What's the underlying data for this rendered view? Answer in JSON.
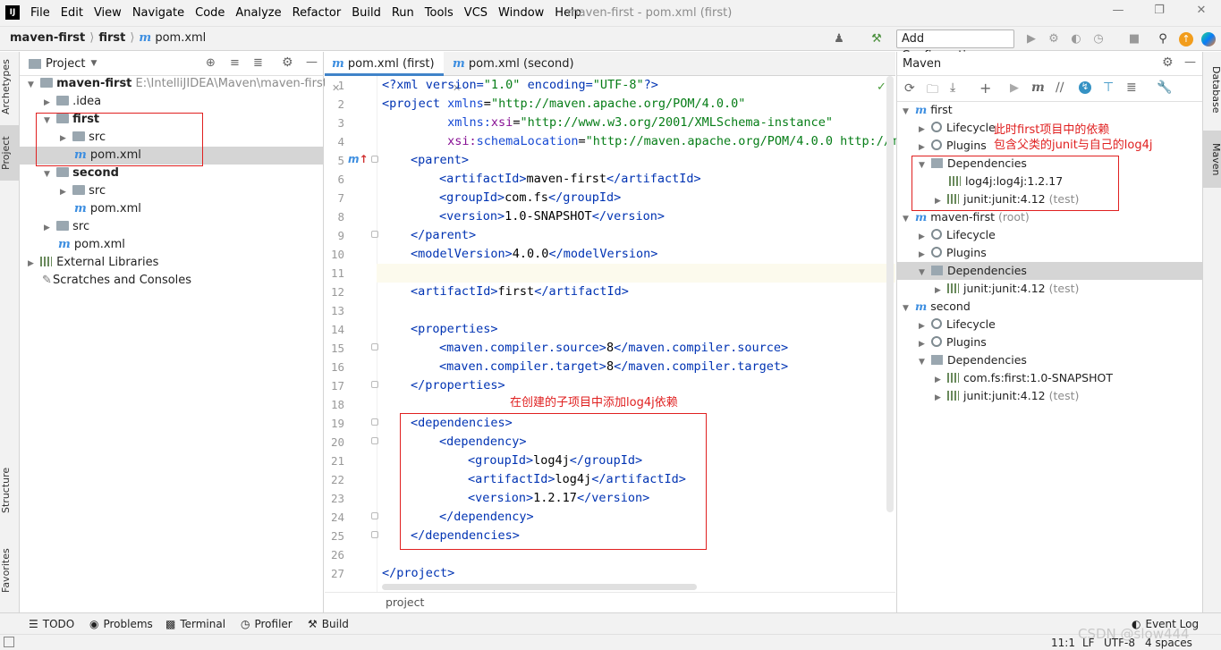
{
  "app": {
    "logo": "IJ",
    "menu": [
      "File",
      "Edit",
      "View",
      "Navigate",
      "Code",
      "Analyze",
      "Refactor",
      "Build",
      "Run",
      "Tools",
      "VCS",
      "Window",
      "Help"
    ],
    "window_title": "maven-first - pom.xml (first)"
  },
  "nav": {
    "breadcrumb": [
      "maven-first",
      "first",
      "pom.xml"
    ],
    "run_config_label": "Add Configuration..."
  },
  "left_strip": {
    "tabs": [
      "Archetypes",
      "Project",
      "Structure",
      "Favorites"
    ]
  },
  "project": {
    "header": "Project",
    "tree": [
      {
        "label": "maven-first",
        "hint": "E:\\IntelliJIDEA\\Maven\\maven-first"
      },
      {
        "label": ".idea"
      },
      {
        "label": "first"
      },
      {
        "label": "src"
      },
      {
        "label": "pom.xml"
      },
      {
        "label": "second"
      },
      {
        "label": "src"
      },
      {
        "label": "pom.xml"
      },
      {
        "label": "src"
      },
      {
        "label": "pom.xml"
      },
      {
        "label": "External Libraries"
      },
      {
        "label": "Scratches and Consoles"
      }
    ]
  },
  "editor": {
    "tabs": [
      "pom.xml (first)",
      "pom.xml (second)"
    ],
    "line_numbers": [
      "1",
      "2",
      "3",
      "4",
      "5",
      "6",
      "7",
      "8",
      "9",
      "10",
      "11",
      "12",
      "13",
      "14",
      "15",
      "16",
      "17",
      "18",
      "19",
      "20",
      "21",
      "22",
      "23",
      "24",
      "25",
      "26",
      "27"
    ],
    "breadcrumb_footer": "project",
    "code": {
      "l1": {
        "a": "<?xml version=",
        "b": "\"1.0\"",
        "c": " encoding=",
        "d": "\"UTF-8\"",
        "e": "?>"
      },
      "l2": {
        "a": "<project ",
        "b": "xmlns",
        "c": "=",
        "d": "\"http://maven.apache.org/POM/4.0.0\""
      },
      "l3": {
        "a": "         xmlns:",
        "b": "xsi",
        "c": "=",
        "d": "\"http://www.w3.org/2001/XMLSchema-instance\""
      },
      "l4": {
        "a": "         xsi:",
        "b": "schemaLocation",
        "c": "=",
        "d": "\"http://maven.apache.org/POM/4.0.0 http://ma"
      },
      "l5": "<parent>",
      "l6": {
        "open": "<artifactId>",
        "val": "maven-first",
        "close": "</artifactId>"
      },
      "l7": {
        "open": "<groupId>",
        "val": "com.fs",
        "close": "</groupId>"
      },
      "l8": {
        "open": "<version>",
        "val": "1.0-SNAPSHOT",
        "close": "</version>"
      },
      "l9": "</parent>",
      "l10": {
        "open": "<modelVersion>",
        "val": "4.0.0",
        "close": "</modelVersion>"
      },
      "l12": {
        "open": "<artifactId>",
        "val": "first",
        "close": "</artifactId>"
      },
      "l14": "<properties>",
      "l15": {
        "open": "<maven.compiler.source>",
        "val": "8",
        "close": "</maven.compiler.source>"
      },
      "l16": {
        "open": "<maven.compiler.target>",
        "val": "8",
        "close": "</maven.compiler.target>"
      },
      "l17": "</properties>",
      "l19": "<dependencies>",
      "l20": "<dependency>",
      "l21": {
        "open": "<groupId>",
        "val": "log4j",
        "close": "</groupId>"
      },
      "l22": {
        "open": "<artifactId>",
        "val": "log4j",
        "close": "</artifactId>"
      },
      "l23": {
        "open": "<version>",
        "val": "1.2.17",
        "close": "</version>"
      },
      "l24": "</dependency>",
      "l25": "</dependencies>",
      "l27": "</project>"
    }
  },
  "maven": {
    "header": "Maven",
    "tree": [
      {
        "label": "first"
      },
      {
        "label": "Lifecycle"
      },
      {
        "label": "Plugins"
      },
      {
        "label": "Dependencies"
      },
      {
        "label": "log4j:log4j:1.2.17"
      },
      {
        "label": "junit:junit:4.12",
        "hint": "(test)"
      },
      {
        "label": "maven-first",
        "hint": "(root)"
      },
      {
        "label": "Lifecycle"
      },
      {
        "label": "Plugins"
      },
      {
        "label": "Dependencies"
      },
      {
        "label": "junit:junit:4.12",
        "hint": "(test)"
      },
      {
        "label": "second"
      },
      {
        "label": "Lifecycle"
      },
      {
        "label": "Plugins"
      },
      {
        "label": "Dependencies"
      },
      {
        "label": "com.fs:first:1.0-SNAPSHOT"
      },
      {
        "label": "junit:junit:4.12",
        "hint": "(test)"
      }
    ]
  },
  "right_strip": {
    "tabs": [
      "Database",
      "Maven"
    ]
  },
  "bottom": {
    "tools": [
      "TODO",
      "Problems",
      "Terminal",
      "Profiler",
      "Build"
    ],
    "event_log": "Event Log"
  },
  "status": {
    "position": "11:1",
    "line_sep": "LF",
    "encoding": "UTF-8",
    "indent": "4 spaces"
  },
  "annotations": {
    "maven_note_1": "此时first项目中的依赖",
    "maven_note_2": "包含父类的junit与自己的log4j",
    "editor_note": "在创建的子项目中添加log4j依赖",
    "watermark": "CSDN @slow444"
  },
  "colors": {
    "annotation": "#e02020",
    "accent": "#4083c9",
    "maven_m": "#3d8ee0"
  }
}
